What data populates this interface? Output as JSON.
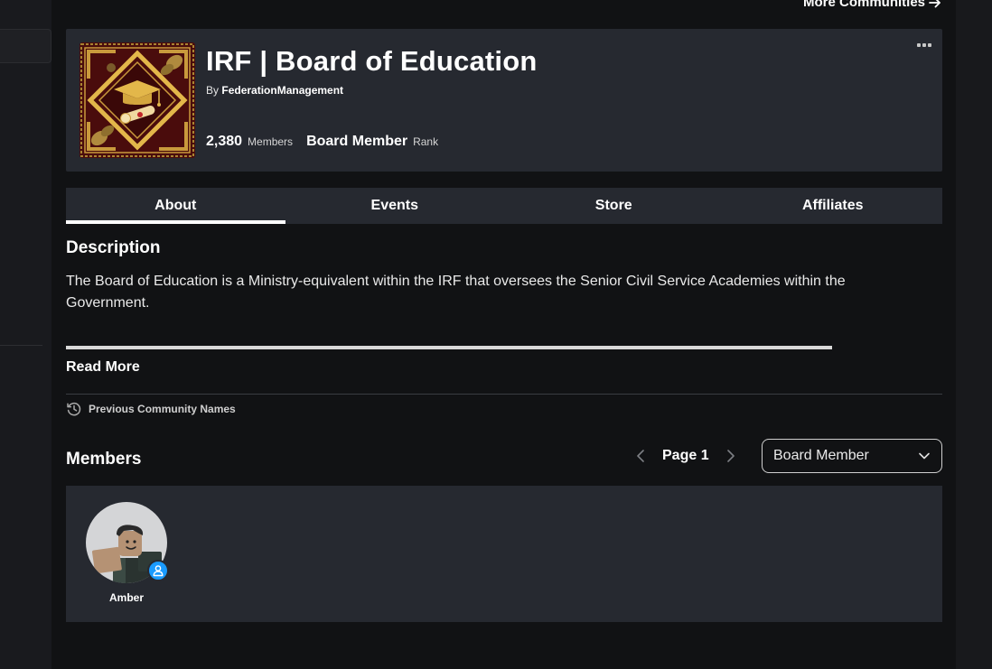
{
  "top_link": {
    "label": "More Communities"
  },
  "group": {
    "title": "IRF | Board of Education",
    "by_prefix": "By",
    "owner": "FederationManagement",
    "member_count": "2,380",
    "member_count_label": "Members",
    "rank_value": "Board Member",
    "rank_label": "Rank"
  },
  "tabs": [
    {
      "label": "About",
      "active": true
    },
    {
      "label": "Events",
      "active": false
    },
    {
      "label": "Store",
      "active": false
    },
    {
      "label": "Affiliates",
      "active": false
    }
  ],
  "description": {
    "heading": "Description",
    "text": "The Board of Education is a Ministry-equivalent within the IRF that oversees the Senior Civil Service Academies within the Government.",
    "read_more": "Read More",
    "previous_names": "Previous Community Names"
  },
  "members": {
    "heading": "Members",
    "page_label": "Page 1",
    "rank_filter": "Board Member",
    "list": [
      {
        "name": "Amber"
      }
    ]
  },
  "colors": {
    "background": "#111214",
    "card": "#262930",
    "accent_blue": "#1a9bff",
    "emblem_gold": "#e3b74a",
    "emblem_red": "#4a0c0c"
  },
  "icons": {
    "more": "ellipsis-icon",
    "history": "history-icon",
    "prev": "chevron-left-icon",
    "next": "chevron-right-icon",
    "dropdown": "chevron-down-icon",
    "arrow": "arrow-right-icon",
    "presence": "user-icon"
  }
}
